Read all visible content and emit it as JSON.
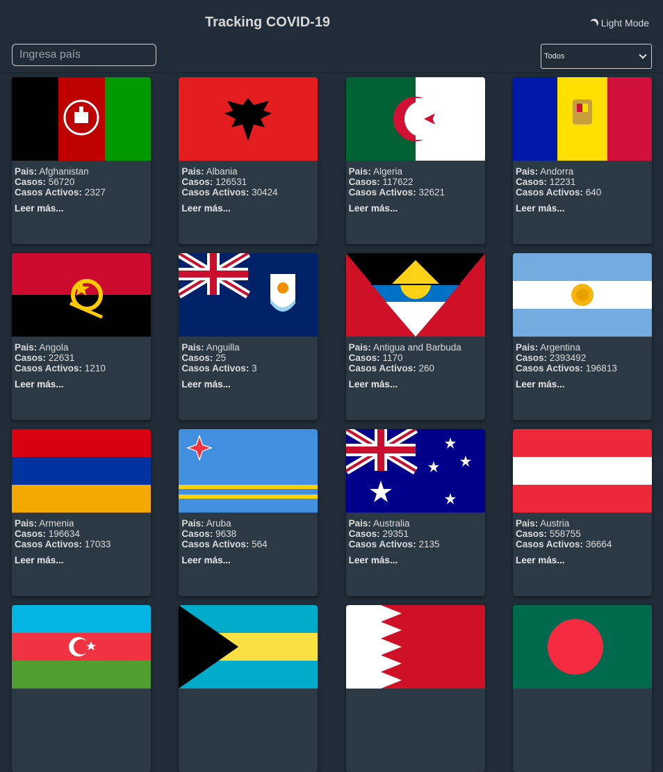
{
  "header": {
    "title": "Tracking COVID-19",
    "theme_toggle": "Light Mode"
  },
  "search": {
    "placeholder": "Ingresa país"
  },
  "filter": {
    "selected": "Todos"
  },
  "labels": {
    "pais": "Pais:",
    "casos": "Casos:",
    "activos": "Casos Activos:",
    "more": "Leer más..."
  },
  "countries": [
    {
      "name": "Afghanistan",
      "cases": "56720",
      "active": "2327"
    },
    {
      "name": "Albania",
      "cases": "126531",
      "active": "30424"
    },
    {
      "name": "Algeria",
      "cases": "117622",
      "active": "32621"
    },
    {
      "name": "Andorra",
      "cases": "12231",
      "active": "640"
    },
    {
      "name": "Angola",
      "cases": "22631",
      "active": "1210"
    },
    {
      "name": "Anguilla",
      "cases": "25",
      "active": "3"
    },
    {
      "name": "Antigua and Barbuda",
      "cases": "1170",
      "active": "260"
    },
    {
      "name": "Argentina",
      "cases": "2393492",
      "active": "196813"
    },
    {
      "name": "Armenia",
      "cases": "196634",
      "active": "17033"
    },
    {
      "name": "Aruba",
      "cases": "9638",
      "active": "564"
    },
    {
      "name": "Australia",
      "cases": "29351",
      "active": "2135"
    },
    {
      "name": "Austria",
      "cases": "558755",
      "active": "36664"
    }
  ]
}
